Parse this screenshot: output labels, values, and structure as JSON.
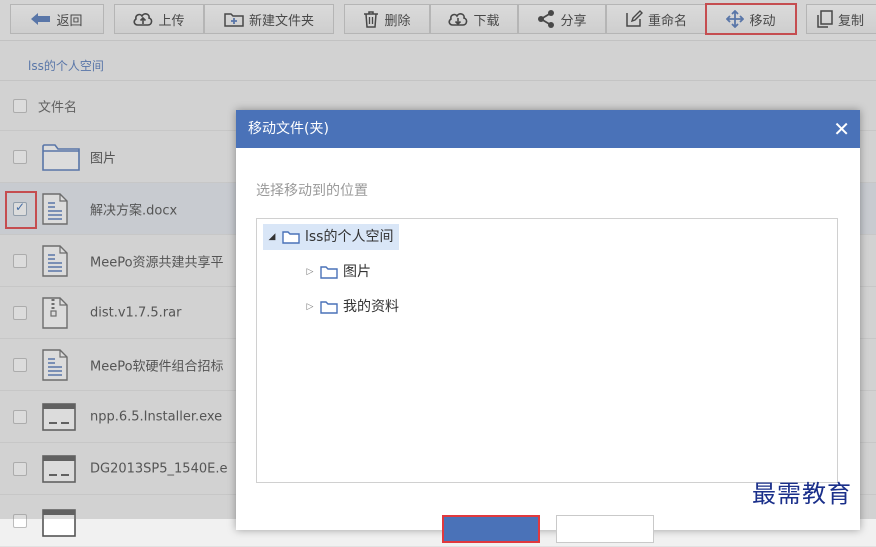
{
  "toolbar": {
    "back": "返回",
    "upload": "上传",
    "new_folder": "新建文件夹",
    "delete": "删除",
    "download": "下载",
    "share": "分享",
    "rename": "重命名",
    "move": "移动",
    "copy": "复制"
  },
  "breadcrumb": "lss的个人空间",
  "file_list": {
    "header_label": "文件名",
    "rows": [
      {
        "name": "图片",
        "type": "folder",
        "checked": false
      },
      {
        "name": "解决方案.docx",
        "type": "doc",
        "checked": true
      },
      {
        "name": "MeePo资源共建共享平",
        "type": "doc",
        "checked": false
      },
      {
        "name": "dist.v1.7.5.rar",
        "type": "archive",
        "checked": false
      },
      {
        "name": "MeePo软硬件组合招标",
        "type": "doc",
        "checked": false
      },
      {
        "name": "npp.6.5.Installer.exe",
        "type": "exe",
        "checked": false
      },
      {
        "name": "DG2013SP5_1540E.e",
        "type": "exe",
        "checked": false
      }
    ]
  },
  "dialog": {
    "title": "移动文件(夹)",
    "close": "✕",
    "prompt": "选择移动到的位置",
    "tree": {
      "root": "lss的个人空间",
      "children": [
        "图片",
        "我的资料"
      ]
    }
  },
  "watermark": "最需教育",
  "colors": {
    "accent": "#4a72b8",
    "highlight": "#e0393e",
    "selected_row": "#e3e8ef"
  }
}
